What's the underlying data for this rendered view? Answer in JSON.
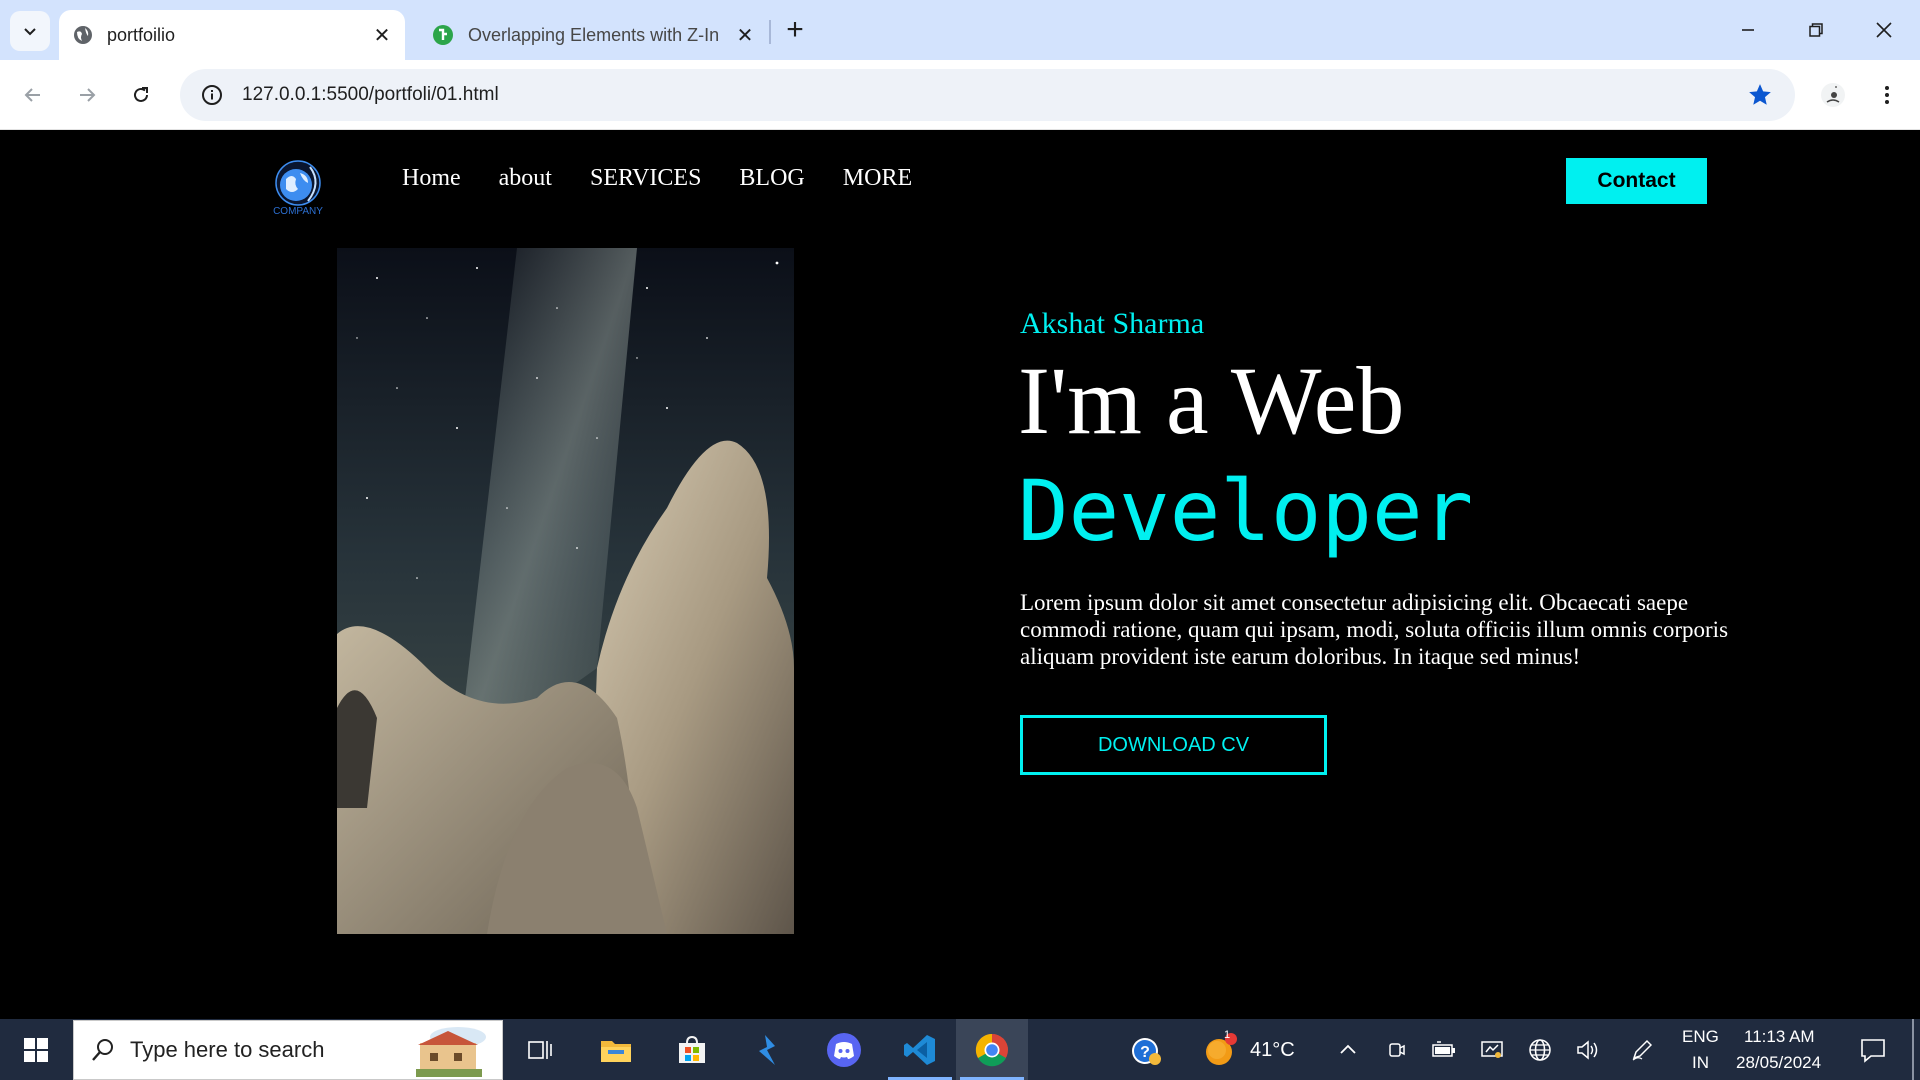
{
  "browser": {
    "tabs": [
      {
        "title": "portfoilio",
        "active": true
      },
      {
        "title": "Overlapping Elements with Z-In",
        "active": false
      }
    ],
    "url": "127.0.0.1:5500/portfoli/01.html"
  },
  "site": {
    "logo_text": "COMPANY",
    "nav": [
      "Home",
      "about",
      "SERVICES",
      "BLOG",
      "MORE"
    ],
    "contact_label": "Contact",
    "hero": {
      "name": "Akshat Sharma",
      "line1": "I'm a Web",
      "line2": "Developer",
      "paragraph": "Lorem ipsum dolor sit amet consectetur adipisicing elit. Obcaecati saepe commodi ratione, quam qui ipsam, modi, soluta officiis illum omnis corporis aliquam provident iste earum doloribus. In itaque sed minus!",
      "cv_button": "DOWNLOAD CV"
    },
    "accent_color": "#00f0f0"
  },
  "taskbar": {
    "search_placeholder": "Type here to search",
    "weather_temp": "41°C",
    "weather_badge": "1",
    "lang_top": "ENG",
    "lang_bottom": "IN",
    "time": "11:13 AM",
    "date": "28/05/2024"
  }
}
